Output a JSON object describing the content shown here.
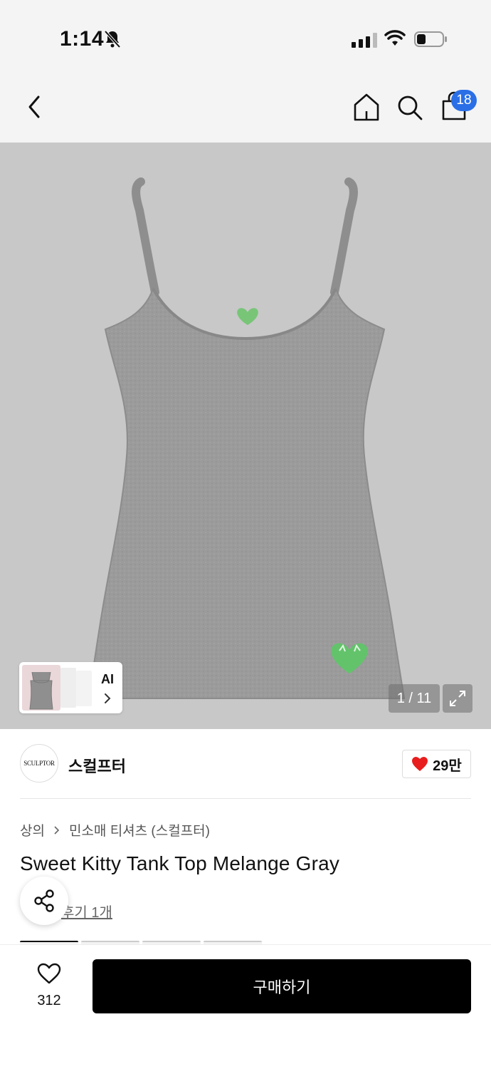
{
  "status_bar": {
    "time": "1:14"
  },
  "header": {
    "cart_count": "18",
    "icons": [
      "back-icon",
      "home-icon",
      "search-icon",
      "shopping-bag-icon"
    ]
  },
  "gallery": {
    "ai_label": "AI",
    "counter": "1 / 11",
    "background_color": "#c8c8c8"
  },
  "brand": {
    "logo_text": "SCULPTOR",
    "name": "스컬프터",
    "likes": "29만",
    "heart_color": "#e81e1e"
  },
  "product": {
    "breadcrumb": [
      "상의",
      "민소매 티셔츠 (스컬프터)"
    ],
    "title": "Sweet Kitty Tank Top Melange Gray",
    "review_link": "후기 1개"
  },
  "bottom_bar": {
    "wishlist_count": "312",
    "buy_label": "구매하기",
    "accent": "#2a6fe6"
  }
}
